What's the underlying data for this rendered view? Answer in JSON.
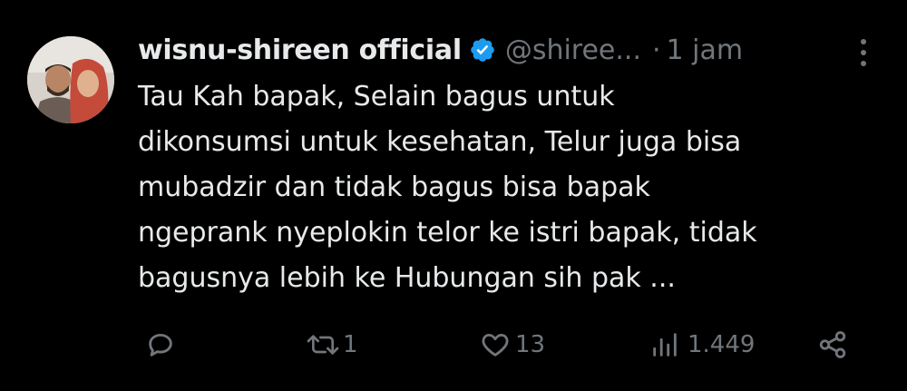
{
  "tweet": {
    "display_name": "wisnu-shireen official",
    "handle": "@shiree...",
    "separator": "·",
    "time": "1 jam",
    "text": "Tau Kah bapak, Selain bagus untuk\ndikonsumsi untuk kesehatan, Telur juga bisa\nmubadzir dan tidak bagus bisa bapak\nngeprank nyeplokin telor ke istri bapak, tidak\nbagusnya lebih ke Hubungan sih pak ...",
    "verified_icon": "verified-badge-icon",
    "accent_color": "#1d9bf0"
  },
  "actions": {
    "reply": {
      "icon": "reply-icon",
      "count": ""
    },
    "repost": {
      "icon": "repost-icon",
      "count": "1"
    },
    "like": {
      "icon": "heart-icon",
      "count": "13"
    },
    "views": {
      "icon": "views-chart-icon",
      "count": "1.449"
    },
    "share": {
      "icon": "share-icon",
      "count": ""
    }
  }
}
